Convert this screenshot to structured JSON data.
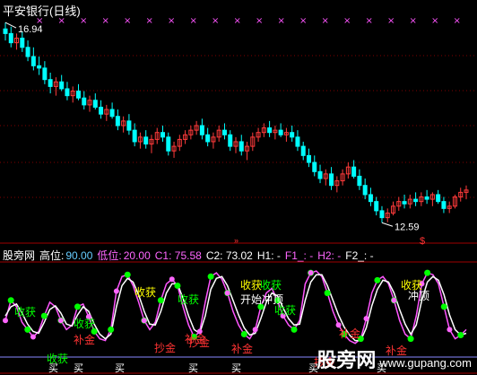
{
  "title": "平安银行(日线)",
  "upper": {
    "high_label": "16.94",
    "low_label": "12.59",
    "candles": [
      [
        16.8,
        16.94,
        16.55,
        16.7
      ],
      [
        16.7,
        16.85,
        16.4,
        16.5
      ],
      [
        16.5,
        16.7,
        16.35,
        16.6
      ],
      [
        16.6,
        16.75,
        16.3,
        16.4
      ],
      [
        16.4,
        16.55,
        16.1,
        16.2
      ],
      [
        16.2,
        16.4,
        15.9,
        16.0
      ],
      [
        16.0,
        16.2,
        15.8,
        15.95
      ],
      [
        15.95,
        16.1,
        15.6,
        15.7
      ],
      [
        15.7,
        15.85,
        15.4,
        15.55
      ],
      [
        15.55,
        15.75,
        15.35,
        15.65
      ],
      [
        15.65,
        15.8,
        15.45,
        15.5
      ],
      [
        15.5,
        15.65,
        15.25,
        15.35
      ],
      [
        15.35,
        15.55,
        15.2,
        15.45
      ],
      [
        15.45,
        15.6,
        15.25,
        15.3
      ],
      [
        15.3,
        15.45,
        15.05,
        15.15
      ],
      [
        15.15,
        15.35,
        15.0,
        15.25
      ],
      [
        15.25,
        15.4,
        15.05,
        15.1
      ],
      [
        15.1,
        15.25,
        14.85,
        14.95
      ],
      [
        14.95,
        15.15,
        14.8,
        15.05
      ],
      [
        15.05,
        15.2,
        14.85,
        14.9
      ],
      [
        14.9,
        15.05,
        14.6,
        14.7
      ],
      [
        14.7,
        14.9,
        14.55,
        14.8
      ],
      [
        14.8,
        14.95,
        14.5,
        14.6
      ],
      [
        14.6,
        14.75,
        14.25,
        14.35
      ],
      [
        14.35,
        14.55,
        14.2,
        14.45
      ],
      [
        14.45,
        14.6,
        14.2,
        14.3
      ],
      [
        14.3,
        14.5,
        14.1,
        14.4
      ],
      [
        14.4,
        14.65,
        14.3,
        14.55
      ],
      [
        14.55,
        14.7,
        14.35,
        14.45
      ],
      [
        14.45,
        14.55,
        14.05,
        14.15
      ],
      [
        14.15,
        14.35,
        14.0,
        14.25
      ],
      [
        14.25,
        14.5,
        14.15,
        14.4
      ],
      [
        14.4,
        14.6,
        14.3,
        14.5
      ],
      [
        14.5,
        14.7,
        14.4,
        14.6
      ],
      [
        14.6,
        14.8,
        14.5,
        14.7
      ],
      [
        14.7,
        14.85,
        14.4,
        14.5
      ],
      [
        14.5,
        14.65,
        14.25,
        14.35
      ],
      [
        14.35,
        14.55,
        14.2,
        14.45
      ],
      [
        14.45,
        14.7,
        14.35,
        14.6
      ],
      [
        14.6,
        14.75,
        14.4,
        14.5
      ],
      [
        14.5,
        14.6,
        14.15,
        14.25
      ],
      [
        14.25,
        14.45,
        14.1,
        14.35
      ],
      [
        14.35,
        14.5,
        14.05,
        14.15
      ],
      [
        14.15,
        14.35,
        13.95,
        14.25
      ],
      [
        14.25,
        14.55,
        14.15,
        14.45
      ],
      [
        14.45,
        14.65,
        14.35,
        14.55
      ],
      [
        14.55,
        14.75,
        14.45,
        14.65
      ],
      [
        14.65,
        14.8,
        14.45,
        14.55
      ],
      [
        14.55,
        14.7,
        14.4,
        14.6
      ],
      [
        14.6,
        14.75,
        14.45,
        14.5
      ],
      [
        14.5,
        14.65,
        14.35,
        14.55
      ],
      [
        14.55,
        14.7,
        14.35,
        14.45
      ],
      [
        14.45,
        14.6,
        14.15,
        14.25
      ],
      [
        14.25,
        14.35,
        13.95,
        14.05
      ],
      [
        14.05,
        14.2,
        13.8,
        13.9
      ],
      [
        13.9,
        14.05,
        13.6,
        13.7
      ],
      [
        13.7,
        13.85,
        13.45,
        13.55
      ],
      [
        13.55,
        13.75,
        13.4,
        13.65
      ],
      [
        13.65,
        13.8,
        13.3,
        13.4
      ],
      [
        13.4,
        13.6,
        13.25,
        13.5
      ],
      [
        13.5,
        13.75,
        13.4,
        13.65
      ],
      [
        13.65,
        13.9,
        13.55,
        13.8
      ],
      [
        13.8,
        13.95,
        13.55,
        13.6
      ],
      [
        13.6,
        13.75,
        13.3,
        13.4
      ],
      [
        13.4,
        13.55,
        13.1,
        13.2
      ],
      [
        13.2,
        13.35,
        12.95,
        13.05
      ],
      [
        13.05,
        13.15,
        12.75,
        12.85
      ],
      [
        12.85,
        12.95,
        12.59,
        12.7
      ],
      [
        12.7,
        12.9,
        12.6,
        12.8
      ],
      [
        12.8,
        13.05,
        12.75,
        12.95
      ],
      [
        12.95,
        13.15,
        12.85,
        13.05
      ],
      [
        13.05,
        13.2,
        12.9,
        13.0
      ],
      [
        13.0,
        13.2,
        12.9,
        13.1
      ],
      [
        13.1,
        13.25,
        12.95,
        13.05
      ],
      [
        13.05,
        13.25,
        12.95,
        13.15
      ],
      [
        13.15,
        13.3,
        13.0,
        13.1
      ],
      [
        13.1,
        13.25,
        12.95,
        13.2
      ],
      [
        13.2,
        13.3,
        13.0,
        13.05
      ],
      [
        13.05,
        13.15,
        12.8,
        12.9
      ],
      [
        12.9,
        13.05,
        12.8,
        12.95
      ],
      [
        12.95,
        13.2,
        12.9,
        13.15
      ],
      [
        13.15,
        13.35,
        13.05,
        13.25
      ],
      [
        13.25,
        13.4,
        13.1,
        13.3
      ]
    ],
    "top_markers": [
      "×",
      "×",
      "×",
      "×",
      "×",
      "×",
      "×",
      "×",
      "×",
      "×",
      "×",
      "×",
      "×",
      "×",
      "×",
      "×",
      "×",
      "×",
      "×",
      "×"
    ]
  },
  "indicator_header": {
    "name": "股旁网",
    "high_label": "高位:",
    "high_value": "90.00",
    "low_label": "低位:",
    "low_value": "20.00",
    "c1": "C1: 75.58",
    "c2": "C2: 73.02",
    "h1": "H1: -",
    "f1": "F1_: -",
    "h2": "H2: -",
    "f2": "F2_: -"
  },
  "chart_data": {
    "type": "line",
    "y_lim": [
      0,
      100
    ],
    "series": [
      {
        "values": [
          40,
          62,
          55,
          38,
          30,
          22,
          28,
          45,
          60,
          55,
          40,
          30,
          35,
          55,
          58,
          44,
          28,
          20,
          18,
          30,
          72,
          88,
          90,
          78,
          60,
          40,
          30,
          38,
          62,
          80,
          85,
          78,
          55,
          35,
          22,
          28,
          60,
          88,
          92,
          85,
          70,
          50,
          35,
          25,
          20,
          30,
          55,
          70,
          75,
          62,
          45,
          35,
          30,
          40,
          80,
          92,
          94,
          88,
          70,
          50,
          35,
          25,
          18,
          15,
          20,
          42,
          70,
          84,
          88,
          80,
          62,
          40,
          25,
          20,
          45,
          80,
          92,
          90,
          80,
          55,
          30,
          20,
          24,
          30
        ]
      },
      {
        "values": [
          45,
          55,
          58,
          48,
          36,
          28,
          26,
          38,
          52,
          56,
          48,
          36,
          34,
          46,
          55,
          50,
          36,
          25,
          20,
          25,
          55,
          78,
          86,
          82,
          68,
          50,
          36,
          35,
          50,
          70,
          80,
          80,
          64,
          45,
          30,
          26,
          45,
          74,
          86,
          88,
          78,
          62,
          46,
          32,
          24,
          26,
          42,
          60,
          70,
          67,
          54,
          42,
          35,
          36,
          62,
          82,
          90,
          90,
          78,
          62,
          46,
          33,
          24,
          18,
          18,
          32,
          56,
          74,
          84,
          82,
          70,
          52,
          36,
          25,
          35,
          62,
          82,
          88,
          84,
          68,
          46,
          30,
          24,
          26
        ]
      }
    ],
    "labels": [
      {
        "t": "收获",
        "c": "#00ff00"
      },
      {
        "t": "收获",
        "c": "#00ff00"
      },
      {
        "t": "收获",
        "c": "#ffff00"
      },
      {
        "t": "收获",
        "c": "#00ff00"
      },
      {
        "t": "开始冲顶",
        "c": "#ffffff"
      },
      {
        "t": "收获",
        "c": "#00ff00"
      },
      {
        "t": "收获",
        "c": "#ffff00"
      },
      {
        "t": "冲顶",
        "c": "#ffffff"
      },
      {
        "t": "收获",
        "c": "#ffff00"
      },
      {
        "t": "收获",
        "c": "#00ff00"
      },
      {
        "t": "补金",
        "c": "#ff3333"
      },
      {
        "t": "补金",
        "c": "#ff3333"
      },
      {
        "t": "抄金",
        "c": "#ff3333"
      },
      {
        "t": "抄金",
        "c": "#ff3333"
      },
      {
        "t": "补金",
        "c": "#ff3333"
      },
      {
        "t": "补金",
        "c": "#ff3333"
      },
      {
        "t": "补金",
        "c": "#ff3333"
      },
      {
        "t": "抄金",
        "c": "#ff3333"
      },
      {
        "t": "收获",
        "c": "#00ff00"
      }
    ],
    "buy_label": "买"
  },
  "watermark": {
    "brand": "股旁网",
    "domain": "www.gupang.com"
  },
  "colors": {
    "up": "#ff3b3b",
    "down": "#00ffff",
    "grid": "#800000",
    "ma1": "#ff55ff",
    "ma2": "#ffffff",
    "axis": "#a00000"
  }
}
